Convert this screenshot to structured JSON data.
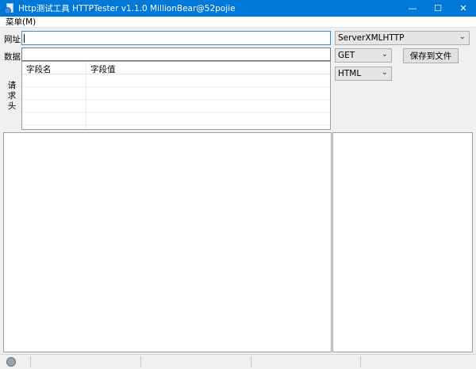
{
  "window": {
    "title": "Http测试工具 HTTPTester v1.1.0    MillionBear@52pojie",
    "controls": {
      "minimize": "—",
      "maximize": "☐",
      "close": "✕"
    }
  },
  "menu": {
    "items": [
      {
        "label": "菜单(M)"
      }
    ]
  },
  "form": {
    "url_label": "网址",
    "url_value": "",
    "data_label": "数据",
    "data_value": "",
    "headers_label": "请求头"
  },
  "headers_grid": {
    "columns": [
      "字段名",
      "字段值"
    ],
    "rows": [
      [
        "",
        ""
      ],
      [
        "",
        ""
      ],
      [
        "",
        ""
      ],
      [
        "",
        ""
      ]
    ]
  },
  "options": {
    "engine": "ServerXMLHTTP",
    "method": "GET",
    "format": "HTML",
    "save_button": "保存到文件"
  }
}
